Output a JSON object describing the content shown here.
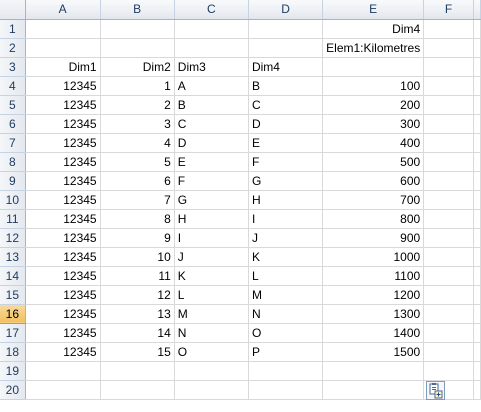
{
  "columns": [
    "A",
    "B",
    "C",
    "D",
    "E",
    "F"
  ],
  "active_row": "16",
  "rows": [
    {
      "n": "1",
      "cells": [
        "",
        "",
        "",
        "",
        "Dim4",
        ""
      ]
    },
    {
      "n": "2",
      "cells": [
        "",
        "",
        "",
        "",
        "Elem1:Kilometres",
        ""
      ]
    },
    {
      "n": "3",
      "cells": [
        "Dim1",
        "Dim2",
        "Dim3",
        "Dim4",
        "",
        ""
      ]
    },
    {
      "n": "4",
      "cells": [
        "12345",
        "1",
        "A",
        "B",
        "100",
        ""
      ]
    },
    {
      "n": "5",
      "cells": [
        "12345",
        "2",
        "B",
        "C",
        "200",
        ""
      ]
    },
    {
      "n": "6",
      "cells": [
        "12345",
        "3",
        "C",
        "D",
        "300",
        ""
      ]
    },
    {
      "n": "7",
      "cells": [
        "12345",
        "4",
        "D",
        "E",
        "400",
        ""
      ]
    },
    {
      "n": "8",
      "cells": [
        "12345",
        "5",
        "E",
        "F",
        "500",
        ""
      ]
    },
    {
      "n": "9",
      "cells": [
        "12345",
        "6",
        "F",
        "G",
        "600",
        ""
      ]
    },
    {
      "n": "10",
      "cells": [
        "12345",
        "7",
        "G",
        "H",
        "700",
        ""
      ]
    },
    {
      "n": "11",
      "cells": [
        "12345",
        "8",
        "H",
        "I",
        "800",
        ""
      ]
    },
    {
      "n": "12",
      "cells": [
        "12345",
        "9",
        "I",
        "J",
        "900",
        ""
      ]
    },
    {
      "n": "13",
      "cells": [
        "12345",
        "10",
        "J",
        "K",
        "1000",
        ""
      ]
    },
    {
      "n": "14",
      "cells": [
        "12345",
        "11",
        "K",
        "L",
        "1100",
        ""
      ]
    },
    {
      "n": "15",
      "cells": [
        "12345",
        "12",
        "L",
        "M",
        "1200",
        ""
      ]
    },
    {
      "n": "16",
      "cells": [
        "12345",
        "13",
        "M",
        "N",
        "1300",
        ""
      ]
    },
    {
      "n": "17",
      "cells": [
        "12345",
        "14",
        "N",
        "O",
        "1400",
        ""
      ]
    },
    {
      "n": "18",
      "cells": [
        "12345",
        "15",
        "O",
        "P",
        "1500",
        ""
      ]
    },
    {
      "n": "19",
      "cells": [
        "",
        "",
        "",
        "",
        "",
        ""
      ]
    },
    {
      "n": "20",
      "cells": [
        "",
        "",
        "",
        "",
        "",
        ""
      ]
    }
  ],
  "numeric_columns": [
    0,
    1,
    4
  ],
  "paste_options_icon": "paste-options-icon"
}
